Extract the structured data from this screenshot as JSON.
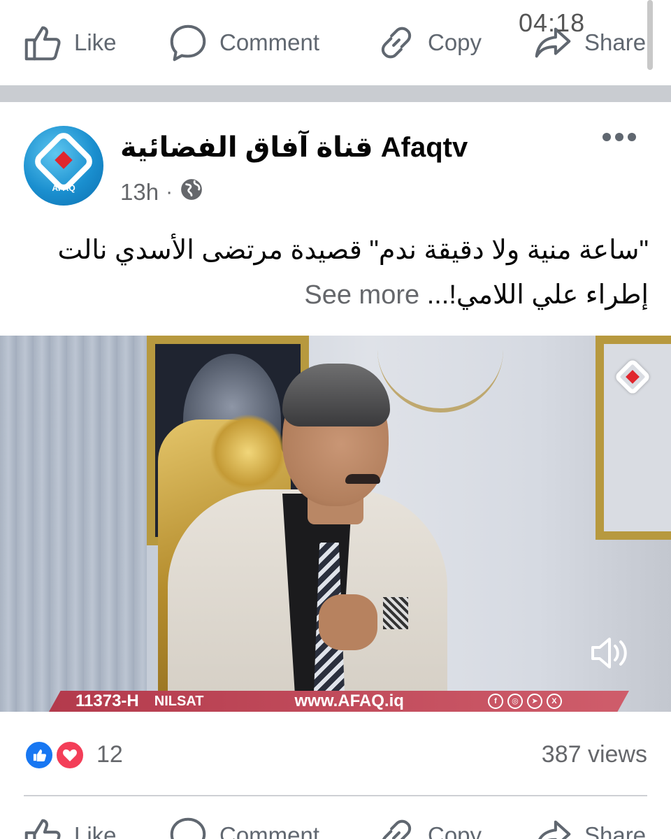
{
  "top_actions": {
    "like": "Like",
    "comment": "Comment",
    "copy": "Copy",
    "share": "Share"
  },
  "video_time": "04:18",
  "post": {
    "page_name": "قناة آفاق الفضائية Afaqtv",
    "avatar_tag": "AFAQ",
    "time": "13h",
    "caption_line1": "\"ساعة منية ولا دقيقة ندم\" قصيدة مرتضى الأسدي نالت",
    "caption_line2": "إطراء علي اللامي!...",
    "see_more": "See more"
  },
  "video": {
    "ticker_sat": "11373-H",
    "ticker_nilsat": "NILSAT",
    "ticker_url": "www.AFAQ.iq",
    "socials": [
      "f",
      "◎",
      "➤",
      "X"
    ]
  },
  "reactions": {
    "count": "12",
    "views": "387 views"
  },
  "bottom_actions": {
    "like": "Like",
    "comment": "Comment",
    "copy": "Copy",
    "share": "Share"
  },
  "colors": {
    "like_blue": "#1877f2",
    "love_red": "#f33e58",
    "icon_gray": "#606770",
    "separator": "#c9ccd1"
  },
  "icons": [
    "thumbs-up-icon",
    "comment-bubble-icon",
    "link-icon",
    "share-arrow-icon",
    "globe-icon",
    "more-dots-icon",
    "speaker-muted-icon",
    "heart-icon"
  ]
}
